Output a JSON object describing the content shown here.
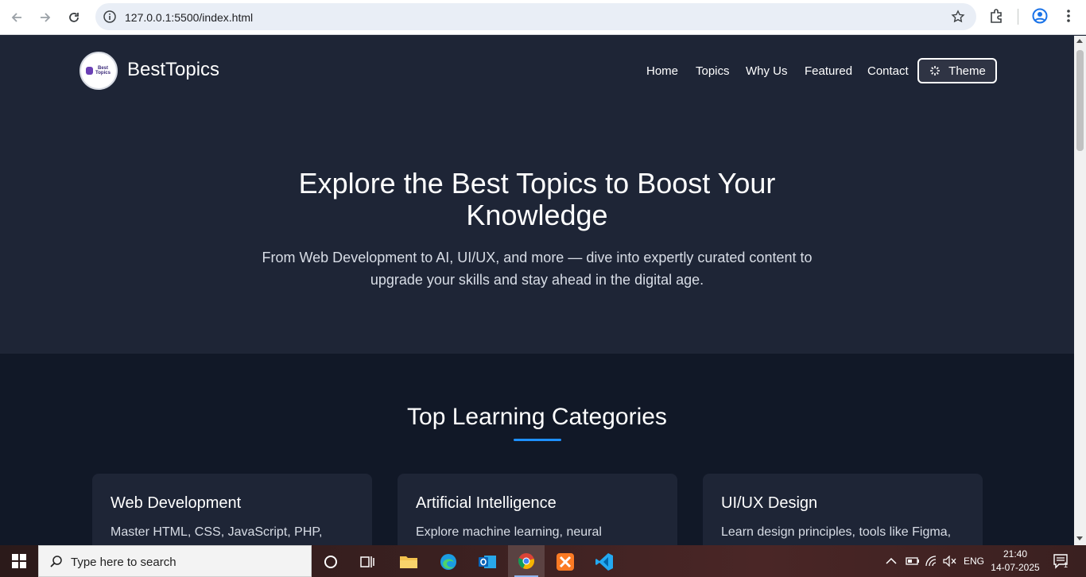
{
  "browser": {
    "url": "127.0.0.1:5500/index.html"
  },
  "site": {
    "brand": "BestTopics",
    "logo_text": "Best Topics",
    "nav": [
      "Home",
      "Topics",
      "Why Us",
      "Featured",
      "Contact"
    ],
    "theme_label": "Theme"
  },
  "hero": {
    "title": "Explore the Best Topics to Boost Your Knowledge",
    "subtitle": "From Web Development to AI, UI/UX, and more — dive into expertly curated content to upgrade your skills and stay ahead in the digital age."
  },
  "categories": {
    "heading": "Top Learning Categories",
    "accent_color": "#1e90ff",
    "cards": [
      {
        "title": "Web Development",
        "text": "Master HTML, CSS, JavaScript, PHP,"
      },
      {
        "title": "Artificial Intelligence",
        "text": "Explore machine learning, neural"
      },
      {
        "title": "UI/UX Design",
        "text": "Learn design principles, tools like Figma,"
      }
    ]
  },
  "taskbar": {
    "search_placeholder": "Type here to search",
    "apps": [
      "task-view",
      "file-explorer",
      "edge",
      "outlook",
      "chrome",
      "xampp",
      "vscode"
    ],
    "active_app": "chrome",
    "language": "ENG",
    "time": "21:40",
    "date": "14-07-2025",
    "notification_count": "1"
  }
}
